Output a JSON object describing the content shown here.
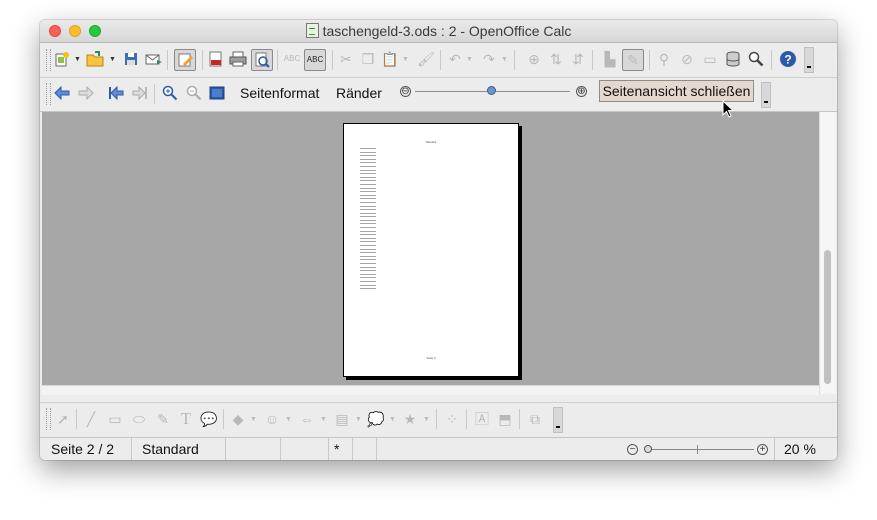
{
  "window": {
    "title": "taschengeld-3.ods : 2 - OpenOffice Calc"
  },
  "standard_toolbar": {
    "icons": [
      "new-document-icon",
      "open-folder-icon",
      "save-icon",
      "email-icon",
      "edit-file-icon",
      "export-pdf-icon",
      "print-icon",
      "page-preview-icon",
      "spellcheck-icon",
      "autospellcheck-icon",
      "cut-icon",
      "copy-icon",
      "paste-icon",
      "clone-formatting-icon",
      "undo-icon",
      "redo-icon",
      "hyperlink-icon",
      "sort-ascending-icon",
      "sort-descending-icon",
      "chart-icon",
      "pivot-table-icon",
      "find-replace-icon",
      "navigator-icon",
      "gallery-icon",
      "data-sources-icon",
      "zoom-icon",
      "help-icon"
    ]
  },
  "preview_toolbar": {
    "page_format_label": "Seitenformat",
    "margins_label": "Ränder",
    "close_preview_label": "Seitenansicht schließen",
    "scale_minus": "⊖",
    "scale_plus": "⊕"
  },
  "preview": {
    "header_text": "Tabelle1",
    "footer_text": "Seite 2",
    "row_count": 40
  },
  "status_bar": {
    "page": "Seite 2 / 2",
    "page_style": "Standard",
    "modified": "*",
    "zoom": "20 %",
    "zoom_level": 0.03
  },
  "colors": {
    "canvas": "#a7a7a7",
    "close_button": "#e3d9cf",
    "icon_blue": "#2b5aa8"
  }
}
